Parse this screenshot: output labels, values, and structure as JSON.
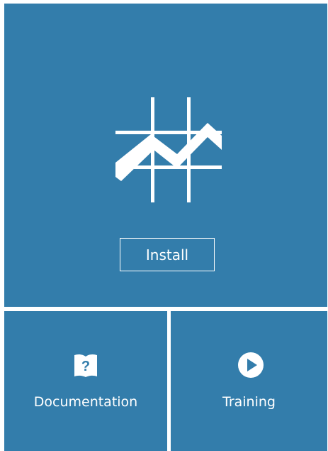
{
  "colors": {
    "tile_background": "#337dab",
    "foreground": "#ffffff",
    "gutter": "#ffffff"
  },
  "main_tile": {
    "logo_icon": "chart-grid-logo-icon",
    "install_label": "Install"
  },
  "documentation_tile": {
    "icon": "book-question-icon",
    "label": "Documentation"
  },
  "training_tile": {
    "icon": "play-circle-icon",
    "label": "Training"
  }
}
